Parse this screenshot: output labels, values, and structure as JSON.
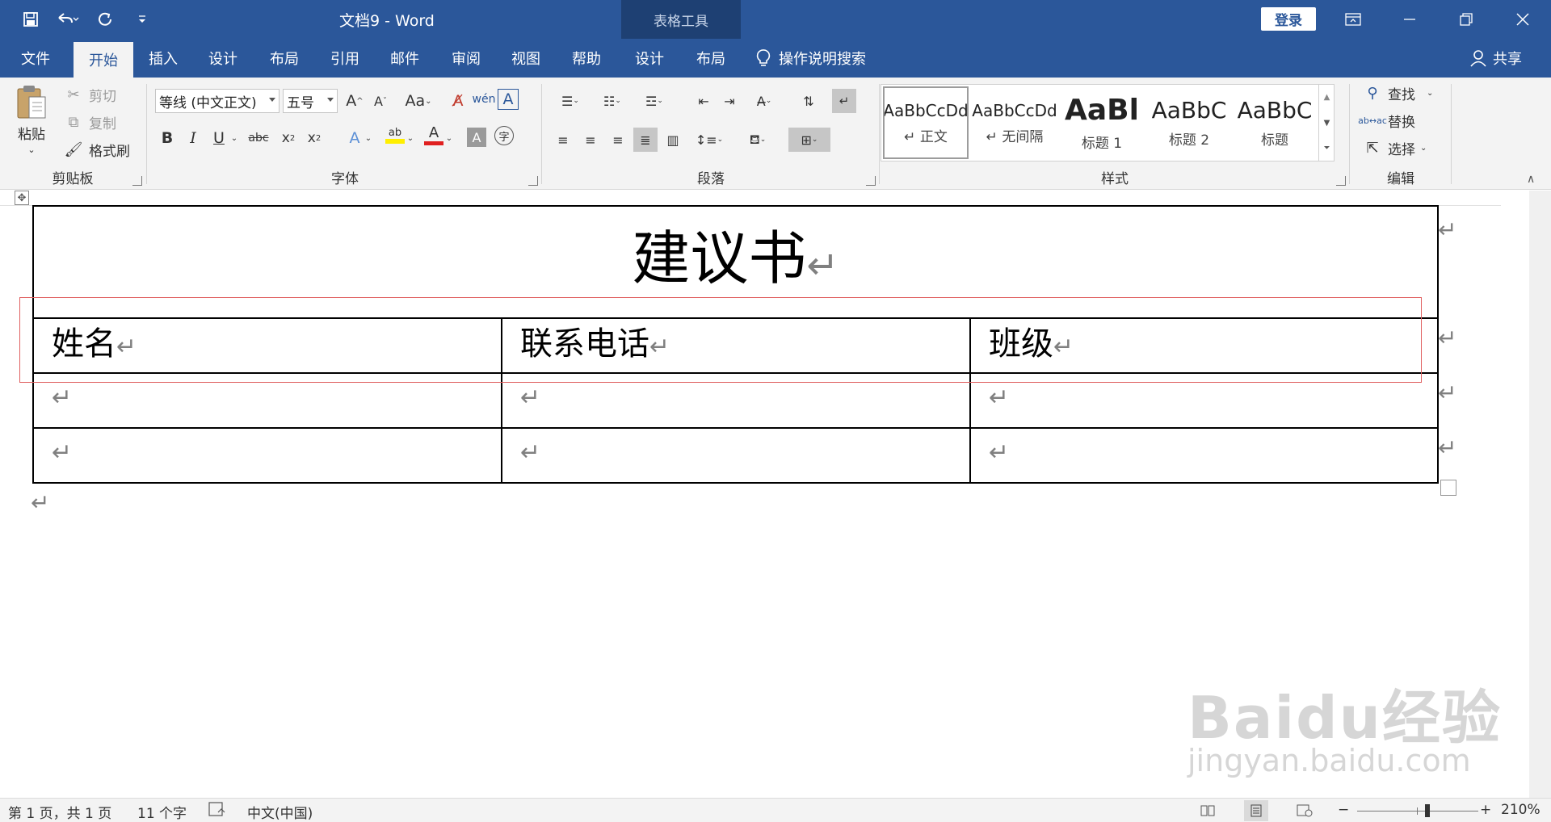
{
  "titlebar": {
    "doc_title": "文档9  -  Word",
    "context_tools": "表格工具",
    "login": "登录"
  },
  "tabs": [
    "文件",
    "开始",
    "插入",
    "设计",
    "布局",
    "引用",
    "邮件",
    "审阅",
    "视图",
    "帮助",
    "设计",
    "布局"
  ],
  "search_tab": "操作说明搜索",
  "share": "共享",
  "ribbon": {
    "clipboard": {
      "label": "剪贴板",
      "paste": "粘贴",
      "cut": "剪切",
      "copy": "复制",
      "format_painter": "格式刷"
    },
    "font": {
      "label": "字体",
      "font_name": "等线 (中文正文)",
      "font_size": "五号"
    },
    "paragraph": {
      "label": "段落"
    },
    "styles": {
      "label": "样式",
      "items": [
        {
          "sample": "AaBbCcDd",
          "name": "↵ 正文"
        },
        {
          "sample": "AaBbCcDd",
          "name": "↵ 无间隔"
        },
        {
          "sample": "AaBl",
          "name": "标题 1"
        },
        {
          "sample": "AaBbC",
          "name": "标题 2"
        },
        {
          "sample": "AaBbC",
          "name": "标题"
        }
      ]
    },
    "editing": {
      "label": "编辑",
      "find": "查找",
      "replace": "替换",
      "select": "选择"
    }
  },
  "document": {
    "title": "建议书",
    "headers": [
      "姓名",
      "联系电话",
      "班级"
    ],
    "paragraph_mark": "↵"
  },
  "status": {
    "page": "第 1 页，共 1 页",
    "words": "11 个字",
    "language": "中文(中国)",
    "zoom": "210%",
    "zoom_minus": "−",
    "zoom_plus": "+"
  },
  "watermark": {
    "logo": "Baidu经验",
    "url": "jingyan.baidu.com"
  },
  "colors": {
    "accent": "#2b579a",
    "tools": "#1e4073",
    "selection": "#e06060"
  }
}
